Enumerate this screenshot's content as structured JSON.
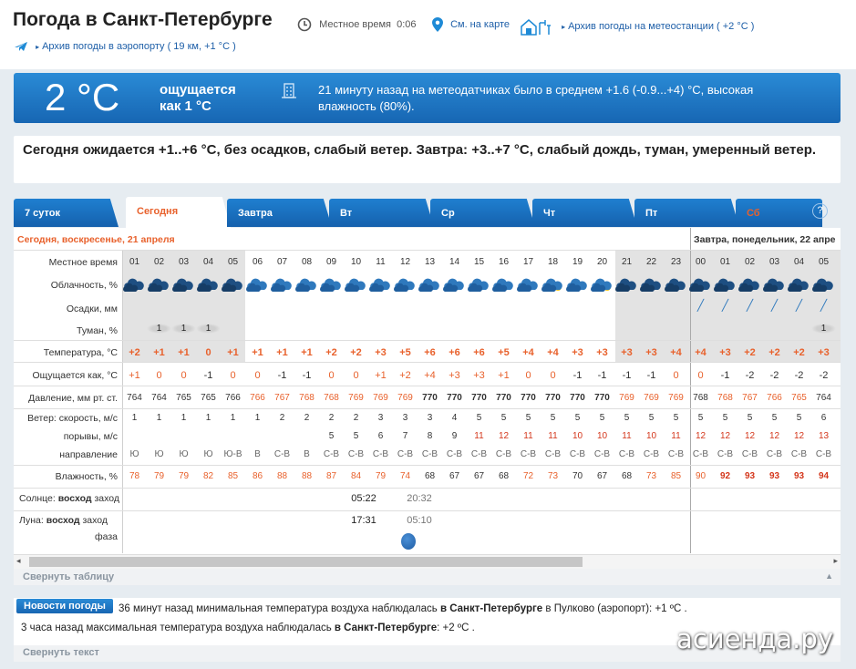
{
  "header": {
    "title": "Погода в Санкт-Петербурге",
    "local_time_label": "Местное время",
    "local_time": "0:06",
    "map_link": "См. на карте",
    "archive_station": "Архив погоды на метеостанции ( +2 °C )",
    "archive_airport": "Архив погоды в аэропорту ( 19 км, +1 °C )"
  },
  "current": {
    "temp": "2 °C",
    "feels_line1": "ощущается",
    "feels_line2": "как 1 °C",
    "sensor_text": "21 минуту назад на метеодатчиках было в среднем +1.6 (-0.9...+4) °C, высокая влажность (80%)."
  },
  "forecast_text": "Сегодня ожидается +1..+6 °C, без осадков, слабый ветер. Завтра: +3..+7 °C, слабый дождь, туман, умеренный ветер.",
  "tabs": [
    "7 суток",
    "Сегодня",
    "Завтра",
    "Вт",
    "Ср",
    "Чт",
    "Пт",
    "Сб"
  ],
  "help": "?",
  "table": {
    "date_today": "Сегодня, воскресенье, 21 апреля",
    "date_tomorrow": "Завтра, понедельник, 22 апре",
    "labels": {
      "time": "Местное время",
      "clouds": "Облачность, %",
      "precip": "Осадки, мм",
      "fog": "Туман, %",
      "temp": "Температура, °C",
      "feels": "Ощущается как, °C",
      "pressure": "Давление, мм рт. ст.",
      "wind_speed": "Ветер: скорость, м/с",
      "gusts": "порывы, м/с",
      "direction": "направление",
      "humidity": "Влажность, %",
      "sun_a": "Солнце:",
      "sun_b": "восход",
      "sun_c": "заход",
      "moon_a": "Луна:",
      "moon_b": "восход",
      "moon_c": "заход",
      "phase": "фаза"
    },
    "hours": [
      "01",
      "02",
      "03",
      "04",
      "05",
      "06",
      "07",
      "08",
      "09",
      "10",
      "11",
      "12",
      "13",
      "14",
      "15",
      "16",
      "17",
      "18",
      "19",
      "20",
      "21",
      "22",
      "23",
      "00",
      "01",
      "02",
      "03",
      "04",
      "05"
    ],
    "fog": [
      "1",
      "1",
      "1"
    ],
    "temp": [
      "+2",
      "+1",
      "+1",
      "0",
      "+1",
      "+1",
      "+1",
      "+1",
      "+2",
      "+2",
      "+3",
      "+5",
      "+6",
      "+6",
      "+6",
      "+5",
      "+4",
      "+4",
      "+3",
      "+3",
      "+3",
      "+3",
      "+4",
      "+4",
      "+3",
      "+2",
      "+2",
      "+2",
      "+3"
    ],
    "feels": [
      "+1",
      "0",
      "0",
      "-1",
      "0",
      "0",
      "-1",
      "-1",
      "0",
      "0",
      "+1",
      "+2",
      "+4",
      "+3",
      "+3",
      "+1",
      "0",
      "0",
      "-1",
      "-1",
      "-1",
      "-1",
      "0",
      "0",
      "-1",
      "-2",
      "-2",
      "-2",
      "-2"
    ],
    "pressure": [
      "764",
      "764",
      "765",
      "765",
      "766",
      "766",
      "767",
      "768",
      "768",
      "769",
      "769",
      "769",
      "770",
      "770",
      "770",
      "770",
      "770",
      "770",
      "770",
      "770",
      "769",
      "769",
      "769",
      "768",
      "768",
      "767",
      "766",
      "765",
      "764"
    ],
    "wind": [
      "1",
      "1",
      "1",
      "1",
      "1",
      "1",
      "2",
      "2",
      "2",
      "2",
      "3",
      "3",
      "3",
      "4",
      "5",
      "5",
      "5",
      "5",
      "5",
      "5",
      "5",
      "5",
      "5",
      "5",
      "5",
      "5",
      "5",
      "5",
      "6"
    ],
    "gusts": [
      "",
      "",
      "",
      "",
      "",
      "",
      "",
      "",
      "5",
      "5",
      "6",
      "7",
      "8",
      "9",
      "11",
      "12",
      "11",
      "11",
      "10",
      "10",
      "11",
      "10",
      "11",
      "12",
      "12",
      "12",
      "12",
      "12",
      "13"
    ],
    "direction": [
      "Ю",
      "Ю",
      "Ю",
      "Ю",
      "Ю-В",
      "В",
      "С-В",
      "В",
      "С-В",
      "С-В",
      "С-В",
      "С-В",
      "С-В",
      "С-В",
      "С-В",
      "С-В",
      "С-В",
      "С-В",
      "С-В",
      "С-В",
      "С-В",
      "С-В",
      "С-В",
      "С-В",
      "С-В",
      "С-В",
      "С-В",
      "С-В",
      "С-В"
    ],
    "humidity": [
      "78",
      "79",
      "79",
      "82",
      "85",
      "86",
      "88",
      "88",
      "87",
      "84",
      "79",
      "74",
      "68",
      "67",
      "67",
      "68",
      "72",
      "73",
      "70",
      "67",
      "68",
      "73",
      "85",
      "90",
      "92",
      "93",
      "93",
      "93",
      "94"
    ],
    "sunrise": "05:22",
    "sunset": "20:32",
    "moonrise": "17:31",
    "moonset": "05:10"
  },
  "collapse_table": "Свернуть таблицу",
  "news": {
    "button": "Новости погоды",
    "line1a": "36 минут назад минимальная температура воздуха наблюдалась ",
    "line1b": "в Санкт-Петербурге",
    "line1c": " в Пулково (аэропорт): +1 ºС .",
    "line2a": "3 часа назад максимальная температура воздуха наблюдалась ",
    "line2b": "в Санкт-Петербурге",
    "line2c": ": +2 ºС ."
  },
  "collapse_text": "Свернуть текст",
  "watermark": "асиенда.ру"
}
